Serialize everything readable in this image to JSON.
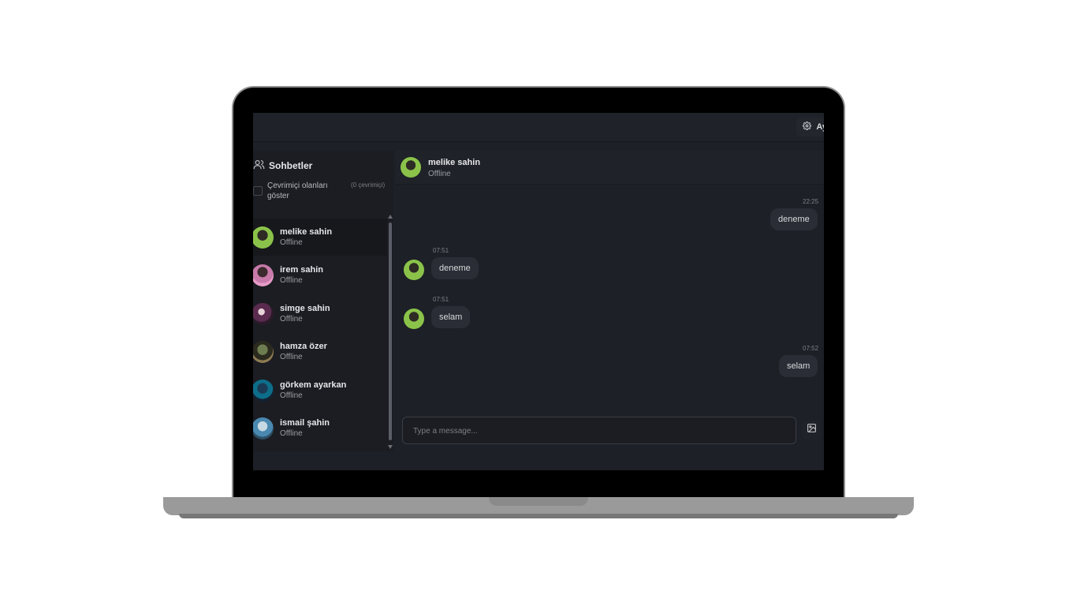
{
  "topbar": {
    "settings_label": "Ay"
  },
  "sidebar": {
    "title": "Sohbetler",
    "online_toggle_label": "Çevrimiçi olanları göster",
    "online_count": "(0 çevrimiçi)",
    "contacts": [
      {
        "name": "melike sahin",
        "status": "Offline",
        "active": true
      },
      {
        "name": "irem sahin",
        "status": "Offline",
        "active": false
      },
      {
        "name": "simge sahin",
        "status": "Offline",
        "active": false
      },
      {
        "name": "hamza özer",
        "status": "Offline",
        "active": false
      },
      {
        "name": "görkem ayarkan",
        "status": "Offline",
        "active": false
      },
      {
        "name": "ismail şahin",
        "status": "Offline",
        "active": false
      }
    ]
  },
  "chat": {
    "contact_name": "melike sahin",
    "contact_status": "Offline",
    "messages": [
      {
        "time": "22:25",
        "text": "deneme",
        "outgoing": true
      },
      {
        "time": "07:51",
        "text": "deneme",
        "outgoing": false
      },
      {
        "time": "07:51",
        "text": "selam",
        "outgoing": false
      },
      {
        "time": "07:52",
        "text": "selam",
        "outgoing": true
      }
    ],
    "input_placeholder": "Type a message..."
  },
  "icons": {
    "settings": "gear-icon",
    "chats": "users-icon",
    "attach_image": "image-icon"
  },
  "colors": {
    "background": "#1d2026",
    "bubble": "#2a2d35"
  }
}
